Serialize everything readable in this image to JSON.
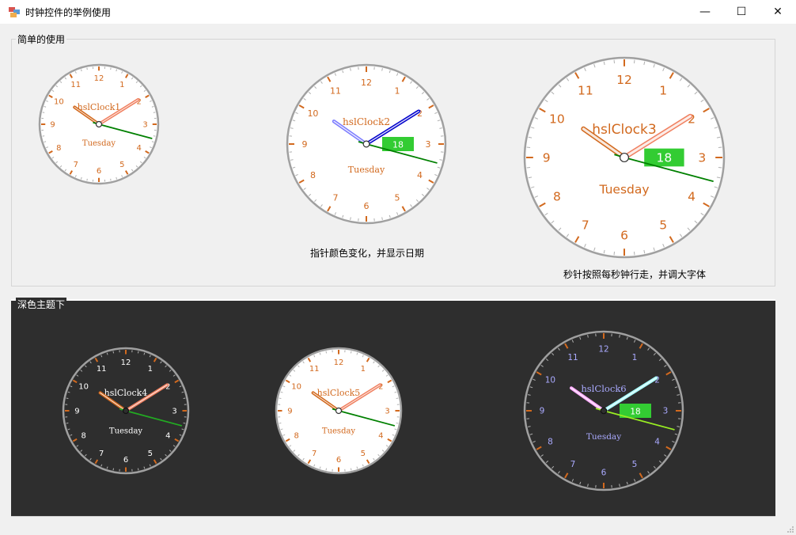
{
  "window": {
    "title": "时钟控件的举例使用",
    "minimize_glyph": "—",
    "maximize_glyph": "☐",
    "close_glyph": "✕"
  },
  "groups": {
    "light": {
      "title": "简单的使用"
    },
    "dark": {
      "title": "深色主题下"
    }
  },
  "captions": {
    "clock2": "指针颜色变化，并显示日期",
    "clock3": "秒针按照每秒钟行走，并调大字体"
  },
  "clocks": [
    {
      "name": "hslClock1",
      "weekday": "Tuesday",
      "date": "",
      "theme": "light",
      "hand_colors": {
        "hour": "#d2691e",
        "minute": "#f08060",
        "second": "#008000"
      },
      "text_color": "#d2691e",
      "tick_color": "#d2691e"
    },
    {
      "name": "hslClock2",
      "weekday": "Tuesday",
      "date": "18",
      "theme": "light",
      "hand_colors": {
        "hour": "#7b7bff",
        "minute": "#0000cc",
        "second": "#008000"
      },
      "text_color": "#d2691e",
      "tick_color": "#d2691e"
    },
    {
      "name": "hslClock3",
      "weekday": "Tuesday",
      "date": "18",
      "theme": "light",
      "hand_colors": {
        "hour": "#d2691e",
        "minute": "#f08060",
        "second": "#008000"
      },
      "text_color": "#d2691e",
      "tick_color": "#d2691e"
    },
    {
      "name": "hslClock4",
      "weekday": "Tuesday",
      "date": "",
      "theme": "dark",
      "hand_colors": {
        "hour": "#d2691e",
        "minute": "#f08060",
        "second": "#22aa22"
      },
      "text_color": "#ffffff",
      "tick_color": "#d2691e"
    },
    {
      "name": "hslClock5",
      "weekday": "Tuesday",
      "date": "",
      "theme": "light",
      "hand_colors": {
        "hour": "#d2691e",
        "minute": "#f08060",
        "second": "#008000"
      },
      "text_color": "#d2691e",
      "tick_color": "#d2691e"
    },
    {
      "name": "hslClock6",
      "weekday": "Tuesday",
      "date": "18",
      "theme": "dark",
      "hand_colors": {
        "hour": "#ffaaff",
        "minute": "#aaffff",
        "second": "#99ee22"
      },
      "text_color": "#aaaaff",
      "tick_color": "#d2691e"
    }
  ],
  "clock_numbers": [
    "12",
    "1",
    "2",
    "3",
    "4",
    "5",
    "6",
    "7",
    "8",
    "9",
    "10",
    "11"
  ],
  "date_badge_color": "#33cc33"
}
